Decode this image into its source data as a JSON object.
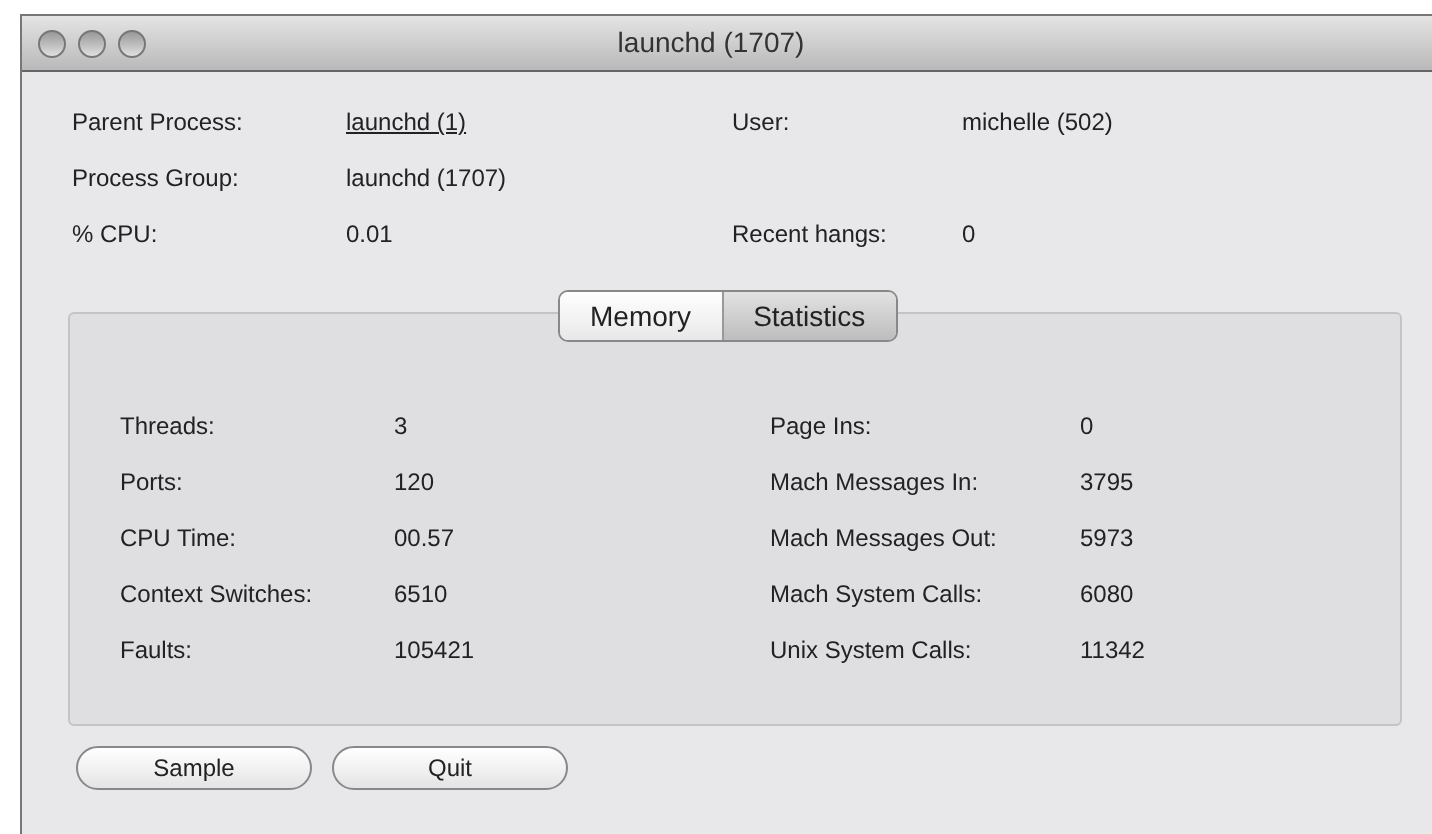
{
  "window": {
    "title": "launchd (1707)"
  },
  "info_rows": [
    {
      "left": {
        "label": "Parent Process:",
        "value": "launchd (1)",
        "link": true
      },
      "right": {
        "label": "User:",
        "value": "michelle (502)",
        "link": false
      }
    },
    {
      "left": {
        "label": "Process Group:",
        "value": "launchd (1707)",
        "link": false
      }
    },
    {
      "left": {
        "label": "% CPU:",
        "value": "0.01",
        "link": false
      },
      "right": {
        "label": "Recent hangs:",
        "value": "0",
        "link": false
      }
    }
  ],
  "tabs": [
    {
      "label": "Memory",
      "selected": false
    },
    {
      "label": "Statistics",
      "selected": true
    }
  ],
  "stats_left": [
    {
      "label": "Threads:",
      "value": "3"
    },
    {
      "label": "Ports:",
      "value": "120"
    },
    {
      "label": "CPU Time:",
      "value": "00.57"
    },
    {
      "label": "Context Switches:",
      "value": "6510"
    },
    {
      "label": "Faults:",
      "value": "105421"
    }
  ],
  "stats_right": [
    {
      "label": "Page Ins:",
      "value": "0"
    },
    {
      "label": "Mach Messages In:",
      "value": "3795"
    },
    {
      "label": "Mach Messages Out:",
      "value": "5973"
    },
    {
      "label": "Mach System Calls:",
      "value": "6080"
    },
    {
      "label": "Unix System Calls:",
      "value": "11342"
    }
  ],
  "buttons": [
    "Sample",
    "Quit"
  ]
}
